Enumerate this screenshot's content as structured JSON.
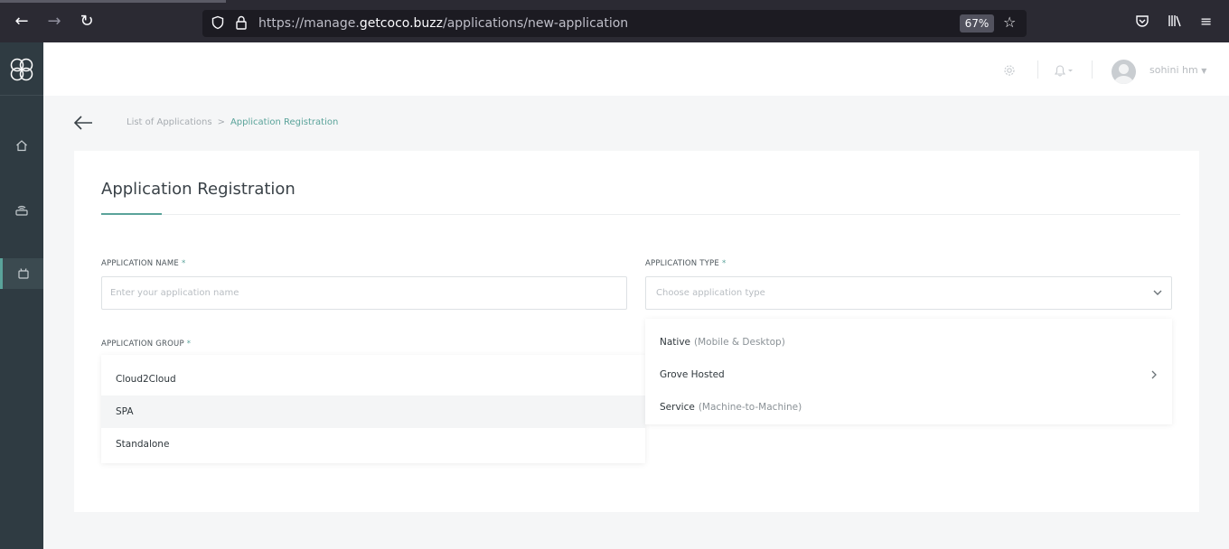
{
  "browser": {
    "url_prefix": "https://manage.",
    "url_host": "getcoco.buzz",
    "url_path": "/applications/new-application",
    "zoom": "67%"
  },
  "header": {
    "user_name": "sohini hm"
  },
  "breadcrumb": {
    "parent": "List of Applications",
    "separator": ">",
    "current": "Application Registration"
  },
  "form": {
    "title": "Application Registration",
    "name_label": "APPLICATION NAME",
    "name_placeholder": "Enter your application name",
    "required_mark": "*",
    "type_label": "APPLICATION TYPE",
    "type_placeholder": "Choose application type",
    "group_label": "APPLICATION GROUP"
  },
  "group_options": [
    "Cloud2Cloud",
    "SPA",
    "Standalone"
  ],
  "type_options": [
    {
      "label": "Native",
      "hint": "(Mobile & Desktop)"
    },
    {
      "label": "Grove Hosted",
      "hint": ""
    },
    {
      "label": "Service",
      "hint": "(Machine-to-Machine)"
    }
  ],
  "colors": {
    "accent": "#5aa39a",
    "sidebar": "#2f3b42",
    "browser_chrome": "#2b2a33"
  }
}
